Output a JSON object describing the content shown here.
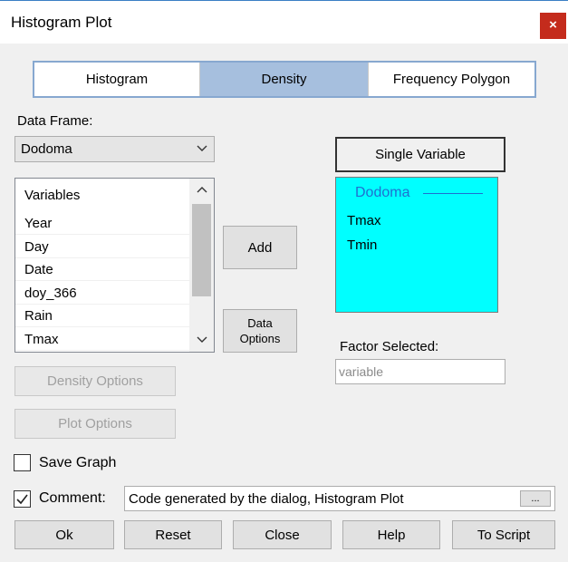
{
  "window": {
    "title": "Histogram Plot",
    "close_label": "×"
  },
  "tabs": [
    {
      "label": "Histogram",
      "active": false
    },
    {
      "label": "Density",
      "active": true
    },
    {
      "label": "Frequency Polygon",
      "active": false
    }
  ],
  "data_frame": {
    "label": "Data Frame:",
    "value": "Dodoma"
  },
  "variables": {
    "header": "Variables",
    "items": [
      "Year",
      "Day",
      "Date",
      "doy_366",
      "Rain",
      "Tmax"
    ]
  },
  "buttons": {
    "add": "Add",
    "data_options_line1": "Data",
    "data_options_line2": "Options",
    "density_options": "Density Options",
    "plot_options": "Plot Options",
    "single_variable": "Single Variable",
    "comment_more": "...",
    "ok": "Ok",
    "reset": "Reset",
    "close": "Close",
    "help": "Help",
    "to_script": "To Script"
  },
  "selected": {
    "group": "Dodoma",
    "items": [
      "Tmax",
      "Tmin"
    ]
  },
  "factor": {
    "label": "Factor Selected:",
    "placeholder": "variable"
  },
  "save_graph": {
    "label": "Save Graph",
    "checked": false
  },
  "comment": {
    "label": "Comment:",
    "checked": true,
    "value": "Code generated by the dialog, Histogram Plot"
  },
  "colors": {
    "selected_bg": "#00ffff",
    "active_tab": "#a6bfde",
    "group_header": "#1f6fd0",
    "close_button": "#c42b1c"
  }
}
